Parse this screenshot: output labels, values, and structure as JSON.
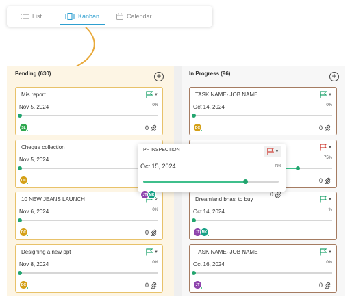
{
  "views": {
    "tabs": [
      {
        "label": "List",
        "icon": "list-icon",
        "active": false
      },
      {
        "label": "Kanban",
        "icon": "kanban-icon",
        "active": true
      },
      {
        "label": "Calendar",
        "icon": "calendar-icon",
        "active": false
      }
    ]
  },
  "colors": {
    "accent": "#2e9fd0",
    "pending_bg": "#fdf5e4",
    "progress_green": "#3fbf8c",
    "flag_green": "#23a56f",
    "flag_red": "#d0433a",
    "arrow": "#e8a93a"
  },
  "columns": [
    {
      "title": "Pending (630)",
      "cards": [
        {
          "title": "Mis report",
          "date": "Nov 5, 2024",
          "percent": "0%",
          "progress": 0,
          "flag": "green",
          "avatars": [
            {
              "initials": "SL",
              "color": "#2fa84f"
            }
          ],
          "count": "0"
        },
        {
          "title": "Cheque collection",
          "date": "Nov 5, 2024",
          "percent": "",
          "progress": 0,
          "flag": "green",
          "avatars": [
            {
              "initials": "DC",
              "color": "#d4a017"
            }
          ],
          "count": "0"
        },
        {
          "title": "10 NEW JEANS LAUNCH",
          "date": "Nov 6, 2024",
          "percent": "0%",
          "progress": 0,
          "flag": "green",
          "avatars": [
            {
              "initials": "DC",
              "color": "#d4a017"
            }
          ],
          "count": "0"
        },
        {
          "title": "Designing a new ppt",
          "date": "Nov 8, 2024",
          "percent": "0%",
          "progress": 0,
          "flag": "green",
          "avatars": [
            {
              "initials": "DC",
              "color": "#d4a017"
            }
          ],
          "count": "0"
        }
      ]
    },
    {
      "title": "In Progress (96)",
      "cards": [
        {
          "title": "TASK NAME- JOB NAME",
          "date": "Oct 14, 2024",
          "percent": "0%",
          "progress": 0,
          "flag": "green",
          "avatars": [
            {
              "initials": "DC",
              "color": "#d4a017"
            }
          ],
          "count": "0"
        },
        {
          "title": "",
          "date": "",
          "percent": "75%",
          "progress": 0.75,
          "flag": "red",
          "avatars": [],
          "count": "0"
        },
        {
          "title": "Dreamland bnasi to buy",
          "date": "Oct 14, 2024",
          "percent": "%",
          "progress": 0,
          "flag": "green",
          "avatars": [
            {
              "initials": "JT",
              "color": "#8e44ad"
            },
            {
              "initials": "MK",
              "color": "#16a085"
            }
          ],
          "count": "0"
        },
        {
          "title": "TASK NAME- JOB NAME",
          "date": "Oct 16, 2024",
          "percent": "0%",
          "progress": 0,
          "flag": "green",
          "avatars": [
            {
              "initials": "JT",
              "color": "#8e44ad"
            }
          ],
          "count": "0"
        }
      ]
    }
  ],
  "dragging": {
    "title": "PF INSPECTION",
    "date": "Oct 15, 2024",
    "percent": "75%",
    "progress": 0.75,
    "flag": "red",
    "avatars": [
      {
        "initials": "JT",
        "color": "#8e44ad"
      },
      {
        "initials": "MK",
        "color": "#16a085"
      }
    ],
    "count": "0"
  }
}
